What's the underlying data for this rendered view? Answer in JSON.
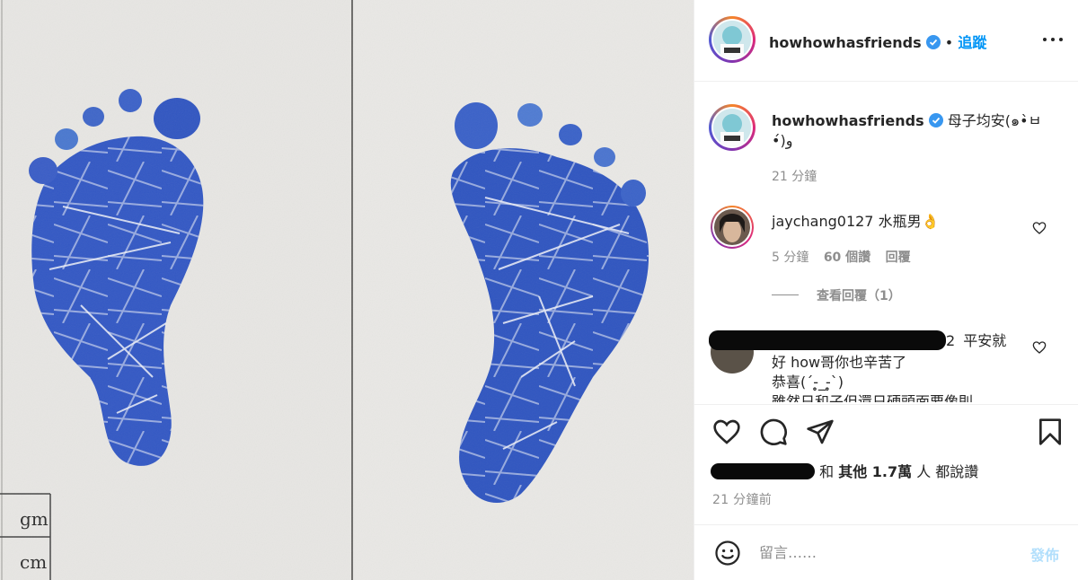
{
  "post": {
    "author": "howhowhasfriends",
    "follow_label": "追蹤",
    "dot": "•",
    "caption_line1": "母子均安(๑•̀ㅂ",
    "caption_line2": "•́)و",
    "caption_time": "21 分鐘"
  },
  "comments": [
    {
      "user": "jaychang0127",
      "text": "水瓶男👌",
      "time": "5 分鐘",
      "likes": "60 個讚",
      "reply_label": "回覆",
      "view_replies": "查看回覆（1）"
    },
    {
      "user_suffix": "2",
      "line1": "平安就",
      "line2": "好 how哥你也辛苦了",
      "line3": "恭喜(´-̥̥̥_-̥̥̥`)",
      "line4": "雖然日和子但還日硬頭面要像則"
    }
  ],
  "likes_line": {
    "and": "和",
    "others": "其他 1.7萬",
    "suffix": "人 都說讚"
  },
  "post_time": "21 分鐘前",
  "composer": {
    "placeholder": "留言……",
    "post_label": "發佈"
  },
  "photo": {
    "table_labels": [
      "gm",
      "cm"
    ]
  },
  "colors": {
    "accent": "#0095f6",
    "ink_blue": "#2b4fc2"
  }
}
